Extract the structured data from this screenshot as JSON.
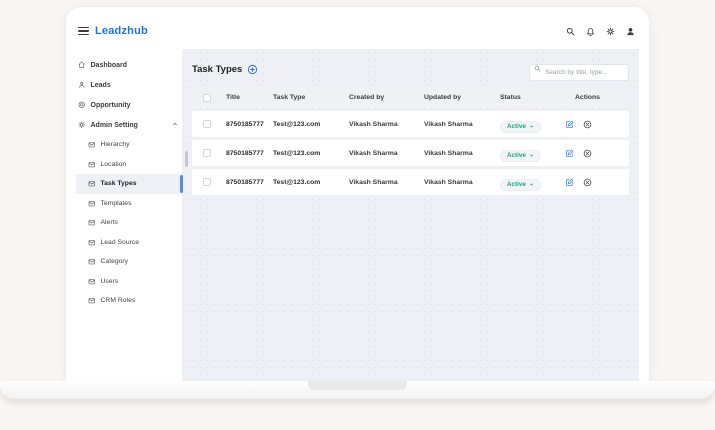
{
  "header": {
    "logo": "Leadzhub",
    "icons": [
      "search-icon",
      "bell-icon",
      "gear-icon",
      "user-icon"
    ]
  },
  "sidebar": {
    "items": [
      {
        "label": "Dashboard",
        "icon": "home-icon"
      },
      {
        "label": "Leads",
        "icon": "user-icon"
      },
      {
        "label": "Opportunity",
        "icon": "target-icon"
      },
      {
        "label": "Admin Setting",
        "icon": "gear-icon",
        "state": "expanded"
      }
    ],
    "admin_sub_items": [
      {
        "label": "Hierarchy"
      },
      {
        "label": "Location"
      },
      {
        "label": "Task Types",
        "selected": true
      },
      {
        "label": "Templates"
      },
      {
        "label": "Alerts"
      },
      {
        "label": "Lead Source"
      },
      {
        "label": "Category"
      },
      {
        "label": "Users"
      },
      {
        "label": "CRM Roles"
      }
    ],
    "sub_item_icon": "envelope-icon",
    "selected_item": "Task Types"
  },
  "main": {
    "title": "Task Types",
    "add_button_icon": "plus-circle-icon",
    "search_placeholder": "Search by title, type...",
    "table": {
      "headers": {
        "title": "Title",
        "task_type": "Task Type",
        "created_by": "Created by",
        "updated_by": "Updated by",
        "status": "Status",
        "actions": "Actions"
      },
      "rows": [
        {
          "title": "8750185777",
          "task_type": "Test@123.com",
          "created_by": "Vikash Sharma",
          "updated_by": "Vikash Sharma",
          "status": "Active"
        },
        {
          "title": "8750185777",
          "task_type": "Test@123.com",
          "created_by": "Vikash Sharma",
          "updated_by": "Vikash Sharma",
          "status": "Active"
        },
        {
          "title": "8750185777",
          "task_type": "Test@123.com",
          "created_by": "Vikash Sharma",
          "updated_by": "Vikash Sharma",
          "status": "Active"
        }
      ],
      "row_action_icons": [
        "edit-icon",
        "circle-x-icon"
      ]
    }
  },
  "colors": {
    "brand_blue": "#1a73e8",
    "active_green": "#15a97c",
    "edit_blue": "#4a90e2",
    "selection_blue": "#4a90e2",
    "main_background": "#eef0f5"
  }
}
